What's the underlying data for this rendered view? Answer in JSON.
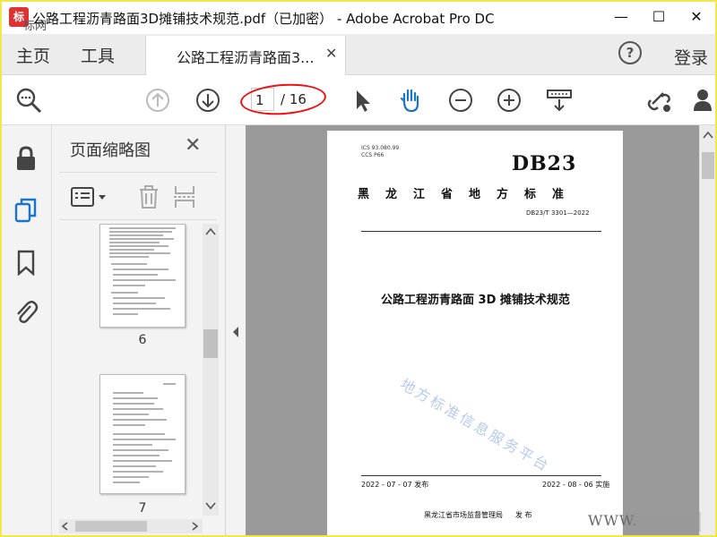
{
  "window": {
    "title": "公路工程沥青路面3D摊铺技术规范.pdf（已加密） - Adobe Acrobat Pro DC",
    "logo_text": "标网",
    "minimize": "—",
    "maximize": "☐",
    "close": "✕"
  },
  "tabs": {
    "home": "主页",
    "tools": "工具",
    "document_tab": "公路工程沥青路面3...",
    "document_tab_close": "✕",
    "help": "?",
    "login": "登录"
  },
  "toolbar": {
    "page_current": "1",
    "page_total": "/ 16"
  },
  "sidebar_panel": {
    "title": "页面缩略图",
    "close": "✕",
    "thumbnails": [
      {
        "label": "6"
      },
      {
        "label": "7"
      }
    ]
  },
  "document": {
    "ics": "ICS   93.080.99",
    "ccs": "CCS  P66",
    "logo": "DB23",
    "standard_name": "黑龙江省地方标准",
    "code": "DB23/T 3301—2022",
    "title": "公路工程沥青路面 3D 摊铺技术规范",
    "watermark": "地方标准信息服务平台",
    "release_date": "2022 - 07 - 07 发布",
    "implement_date": "2022 - 08 - 06 实施",
    "publisher": "黑龙江省市场监督管理局",
    "publish_word": "发  布"
  },
  "overlay": {
    "site_watermark": "WWW."
  },
  "colors": {
    "annotation_red": "#e11111",
    "frame_yellow": "#f0e84a"
  }
}
